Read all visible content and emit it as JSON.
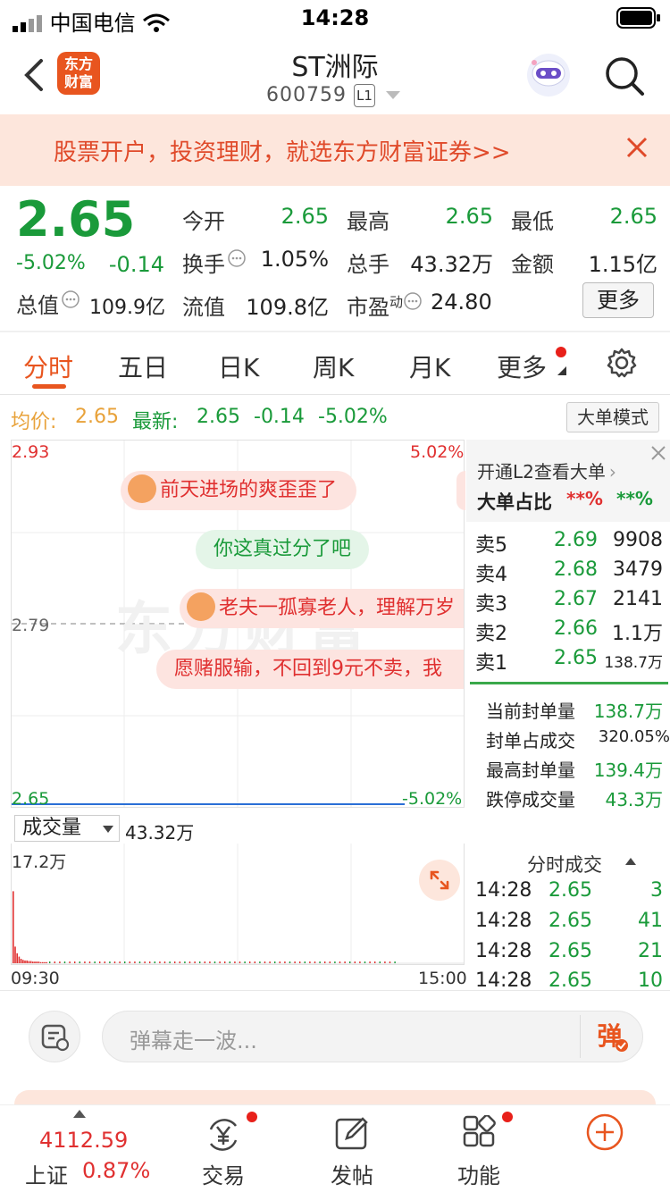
{
  "status_bar": {
    "carrier": "中国电信",
    "time": "14:28"
  },
  "header": {
    "logo_line1": "东方",
    "logo_line2": "财富",
    "title": "ST洲际",
    "code": "600759",
    "level": "L1"
  },
  "banner": {
    "text": "股票开户，投资理财，就选东方财富证券>>"
  },
  "quote": {
    "price": "2.65",
    "change_pct": "-5.02%",
    "change": "-0.14",
    "open_label": "今开",
    "open": "2.65",
    "high_label": "最高",
    "high": "2.65",
    "low_label": "最低",
    "low": "2.65",
    "turnover_label": "换手",
    "turnover": "1.05%",
    "volume_label": "总手",
    "volume": "43.32万",
    "amount_label": "金额",
    "amount": "1.15亿",
    "mcap_label": "总值",
    "mcap": "109.9亿",
    "float_label": "流值",
    "float": "109.8亿",
    "pe_label": "市盈",
    "pe_sup": "动",
    "pe": "24.80",
    "more": "更多"
  },
  "tabs": [
    "分时",
    "五日",
    "日K",
    "周K",
    "月K",
    "更多"
  ],
  "avg_row": {
    "avg_label": "均价:",
    "avg": "2.65",
    "latest_label": "最新:",
    "latest": "2.65",
    "change": "-0.14",
    "change_pct": "-5.02%",
    "big_order_mode": "大单模式"
  },
  "chart": {
    "y_top": "2.93",
    "y_top_pct": "5.02%",
    "y_mid": "2.79",
    "y_bot": "2.65",
    "y_bot_pct": "-5.02%",
    "watermark": "东方财富",
    "danmu": [
      "前天进场的爽歪歪了",
      "你这真过分了吧",
      "老夫一孤寡老人，理解万岁",
      "愿赌服输，不回到9元不卖，我"
    ]
  },
  "volume": {
    "select": "成交量",
    "total": "43.32万",
    "y_max": "17.2万",
    "x_start": "09:30",
    "x_end": "15:00"
  },
  "chart_data": {
    "type": "line",
    "title": "",
    "x_range": [
      "09:30",
      "15:00"
    ],
    "ylim": [
      2.65,
      2.93
    ],
    "series": [
      {
        "values": [
          2.65,
          2.65
        ]
      }
    ],
    "volume_series": {
      "y_max": "17.2万"
    }
  },
  "right_panel": {
    "l2_link": "开通L2查看大单",
    "big_ratio_label": "大单占比",
    "big_ratio_red": "**%",
    "big_ratio_green": "**%",
    "asks": [
      {
        "label": "卖5",
        "price": "2.69",
        "qty": "9908"
      },
      {
        "label": "卖4",
        "price": "2.68",
        "qty": "3479"
      },
      {
        "label": "卖3",
        "price": "2.67",
        "qty": "2141"
      },
      {
        "label": "卖2",
        "price": "2.66",
        "qty": "1.1万"
      },
      {
        "label": "卖1",
        "price": "2.65",
        "qty": "138.7万"
      }
    ],
    "seal_stats": [
      {
        "label": "当前封单量",
        "value": "138.7万"
      },
      {
        "label": "封单占成交",
        "value": "320.05%"
      },
      {
        "label": "最高封单量",
        "value": "139.4万"
      },
      {
        "label": "跌停成交量",
        "value": "43.3万"
      }
    ],
    "ticks_title": "分时成交",
    "ticks": [
      {
        "time": "14:28",
        "price": "2.65",
        "qty": "3"
      },
      {
        "time": "14:28",
        "price": "2.65",
        "qty": "41"
      },
      {
        "time": "14:28",
        "price": "2.65",
        "qty": "21"
      },
      {
        "time": "14:28",
        "price": "2.65",
        "qty": "10"
      }
    ]
  },
  "comment_bar": {
    "placeholder": "弹幕走一波...",
    "danmu_btn": "弹"
  },
  "bottom_nav": {
    "index_value": "4112.59",
    "index_name": "上证",
    "index_pct": "0.87%",
    "trade": "交易",
    "post": "发帖",
    "features": "功能"
  }
}
